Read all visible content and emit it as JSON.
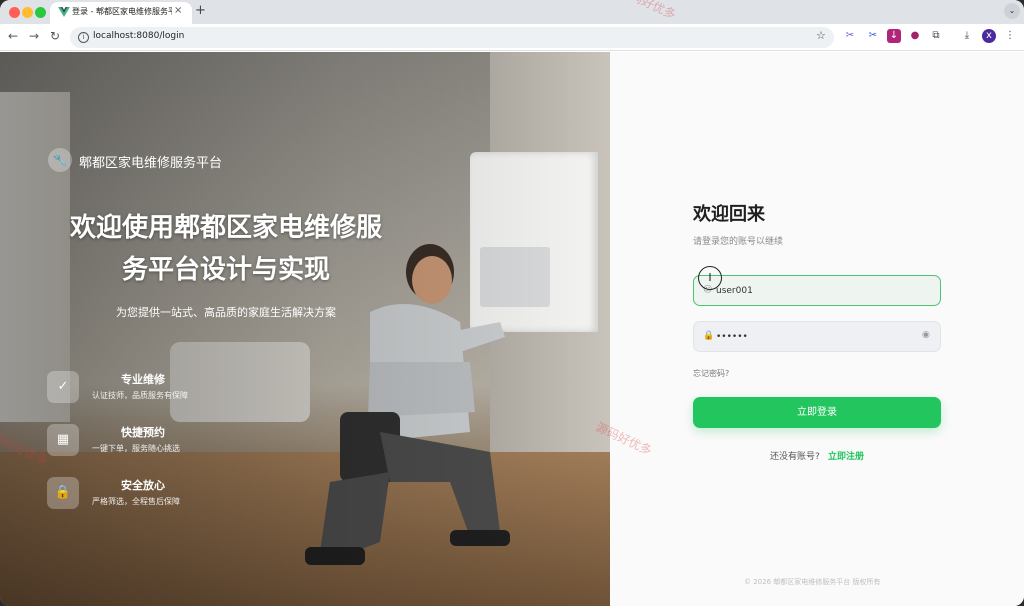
{
  "browser": {
    "tab_title": "登录 - 郫都区家电维修服务平台",
    "tab_close": "×",
    "new_tab": "+",
    "back": "←",
    "forward": "→",
    "reload": "↻",
    "url": "localhost:8080/login",
    "profile_initial": "x"
  },
  "hero": {
    "brand_name": "郫都区家电维修服务平台",
    "title_line1": "欢迎使用郫都区家电维修服",
    "title_line2": "务平台设计与实现",
    "subtitle": "为您提供一站式、高品质的家庭生活解决方案",
    "features": [
      {
        "title": "专业维修",
        "desc": "认证技师，品质服务有保障",
        "icon": "clipboard-check-icon"
      },
      {
        "title": "快捷预约",
        "desc": "一键下单，服务随心挑选",
        "icon": "calendar-icon"
      },
      {
        "title": "安全放心",
        "desc": "严格筛选，全程售后保障",
        "icon": "lock-icon"
      }
    ]
  },
  "login": {
    "heading": "欢迎回来",
    "subheading": "请登录您的账号以继续",
    "username_value": "user001",
    "password_value": "••••••",
    "forgot": "忘记密码?",
    "submit": "立即登录",
    "no_account": "还没有账号?",
    "register": "立即注册",
    "copyright": "© 2026 郫都区家电维修服务平台 版权所有"
  },
  "watermark": "源码好优多",
  "colors": {
    "accent": "#22c55e",
    "focus_border": "#4cc36f"
  }
}
